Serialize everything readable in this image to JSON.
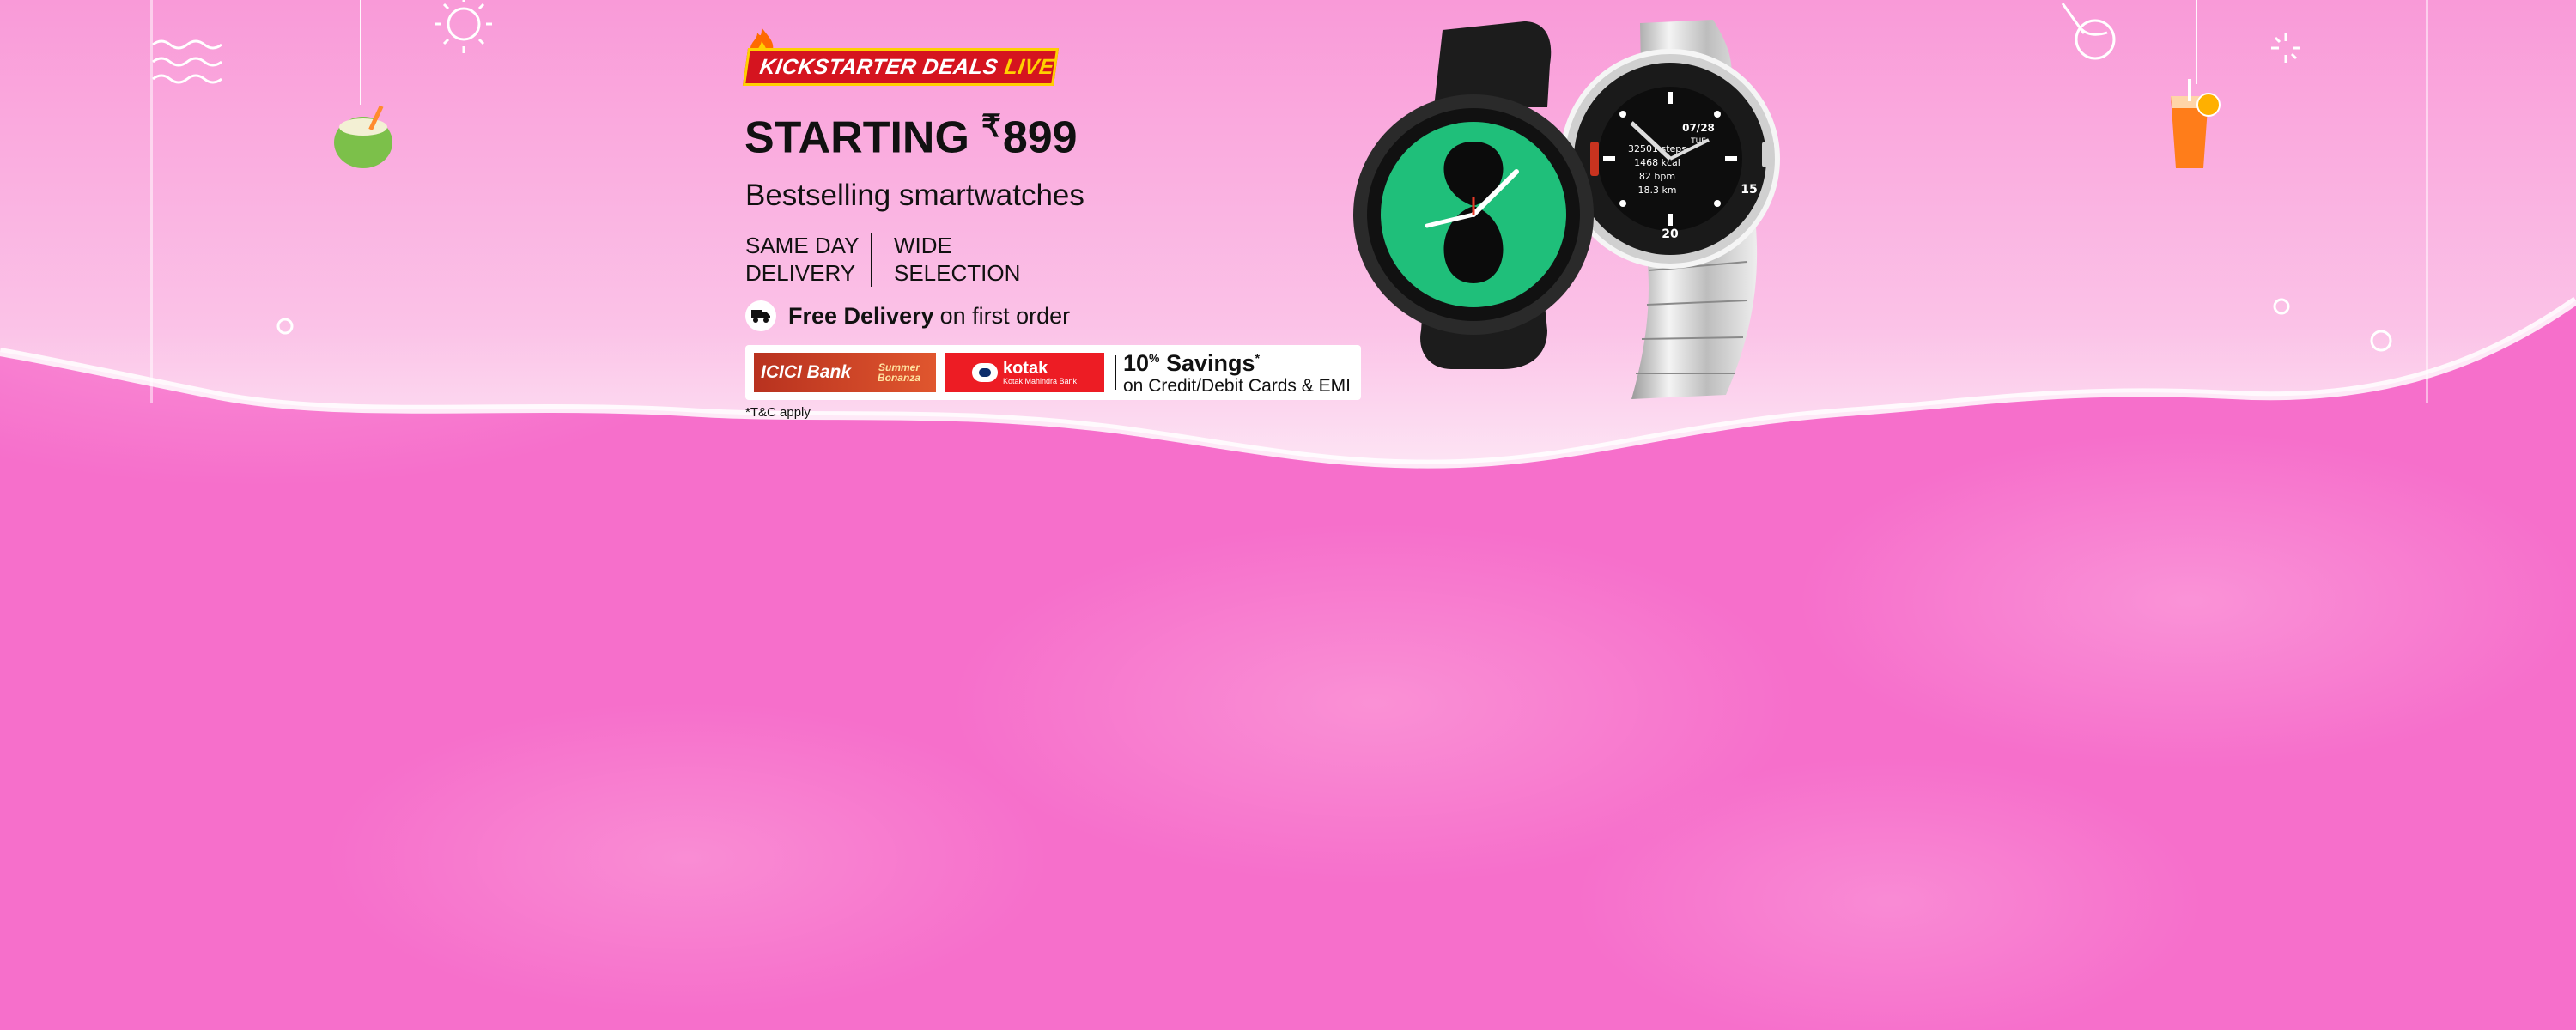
{
  "banner": {
    "badge_prefix": "KICKSTARTER DEALS",
    "badge_live": "LIVE",
    "headline": "STARTING",
    "currency": "₹",
    "price": "899",
    "subtitle": "Bestselling smartwatches",
    "feature_1": "SAME DAY DELIVERY",
    "feature_2": "WIDE SELECTION",
    "delivery_bold": "Free Delivery",
    "delivery_rest": "on first order",
    "bank_1": "ICICI Bank",
    "bank_1_tag": "Summer Bonanza",
    "bank_2": "kotak",
    "bank_2_sub": "Kotak Mahindra Bank",
    "savings_value": "10",
    "savings_pct": "%",
    "savings_label": "Savings",
    "savings_mark": "*",
    "savings_sub": "on Credit/Debit Cards & EMI",
    "tnc": "*T&C apply",
    "watch_time": "07/28",
    "watch_day": "TUE",
    "watch_steps": "32501 steps",
    "watch_kcal": "1468 kcal",
    "watch_bpm": "82 bpm",
    "watch_km": "18.3 km",
    "watch_bezel_1": "15",
    "watch_bezel_2": "20"
  },
  "colors": {
    "background": "#f66fcb",
    "badge_red": "#d5141f",
    "badge_yellow": "#ffd000",
    "watch_face_green": "#1fbf7a",
    "icici_orange": "#c9421f",
    "kotak_red": "#ed1c24"
  },
  "icons": [
    "truck-icon",
    "sun-icon",
    "waves-icon",
    "coconut-icon",
    "ice-cream-icon",
    "juice-icon",
    "sparkle-icon",
    "flame-icon"
  ]
}
